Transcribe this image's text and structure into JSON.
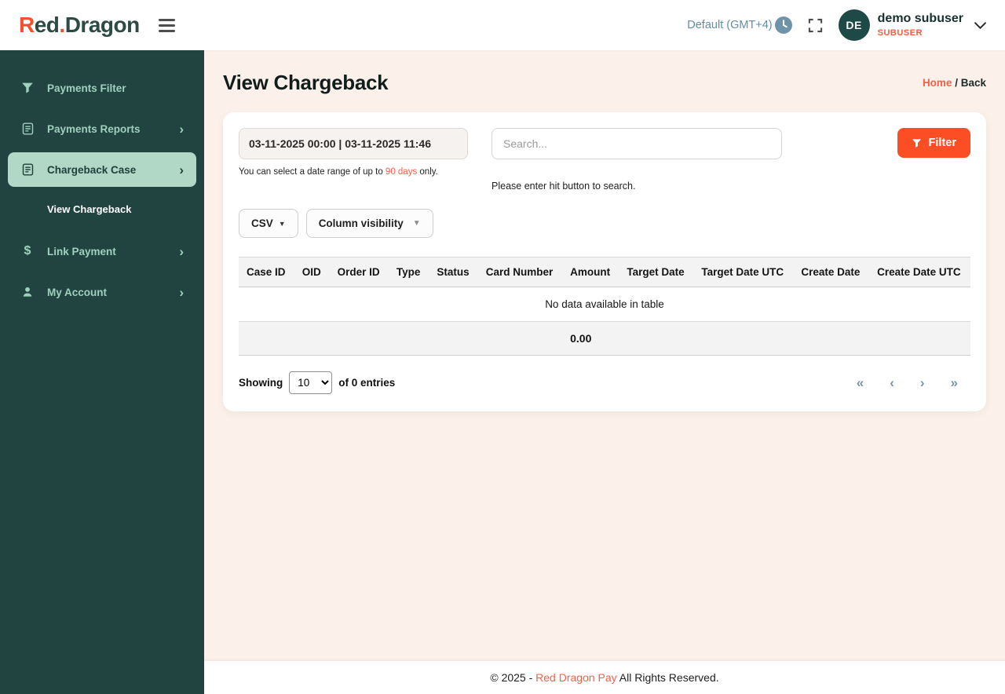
{
  "header": {
    "logo": {
      "r": "R",
      "ed": "ed",
      "dot": ".",
      "dragon": "Dragon"
    },
    "timezone_label": "Default (GMT+4)",
    "user": {
      "initials": "DE",
      "name": "demo subuser",
      "role": "SUBUSER"
    }
  },
  "sidebar": {
    "items": [
      {
        "label": "Payments Filter"
      },
      {
        "label": "Payments Reports"
      },
      {
        "label": "Chargeback Case"
      },
      {
        "label": "Link Payment"
      },
      {
        "label": "My Account"
      }
    ],
    "submenu_label": "View Chargeback"
  },
  "page": {
    "title": "View Chargeback",
    "breadcrumb": {
      "home": "Home",
      "separator": " / ",
      "current": "Back"
    }
  },
  "filters": {
    "date_range_value": "03-11-2025 00:00 | 03-11-2025 11:46",
    "date_hint_prefix": "You can select a date range of up to ",
    "date_hint_highlight": "90 days",
    "date_hint_suffix": " only.",
    "search_placeholder": "Search...",
    "search_hint": "Please enter hit button to search.",
    "filter_button_label": "Filter",
    "csv_button_label": "CSV",
    "column_visibility_label": "Column visibility"
  },
  "table": {
    "columns": [
      "Case ID",
      "OID",
      "Order ID",
      "Type",
      "Status",
      "Card Number",
      "Amount",
      "Target Date",
      "Target Date UTC",
      "Create Date",
      "Create Date UTC"
    ],
    "empty_message": "No data available in table",
    "amount_total": "0.00"
  },
  "pagination": {
    "showing_label": "Showing",
    "page_size": "10",
    "entries_label": "of 0 entries",
    "first": "«",
    "prev": "‹",
    "next": "›",
    "last": "»"
  },
  "icons": {
    "chevron_right": "›",
    "caret_down": "▼",
    "dollar": "$"
  },
  "footer": {
    "prefix": "© 2025 - ",
    "brand": "Red Dragon Pay",
    "suffix": " All Rights Reserved."
  },
  "colors": {
    "accent_orange": "#FB4E24",
    "link_red": "#F4604A",
    "logo_orange": "#F4502C",
    "logo_dark": "#2D4A45",
    "sidebar_bg": "#224441",
    "sidebar_text": "#9ED0BC",
    "sidebar_active_bg": "#B1D8C6",
    "avatar_bg": "#1D4946",
    "timezone_text": "#618EA6",
    "clock_badge_bg": "#6F93A9",
    "main_bg": "#FCF1EA",
    "table_header_bg": "#F3F3F3",
    "pager_arrow": "#7B93A3"
  }
}
